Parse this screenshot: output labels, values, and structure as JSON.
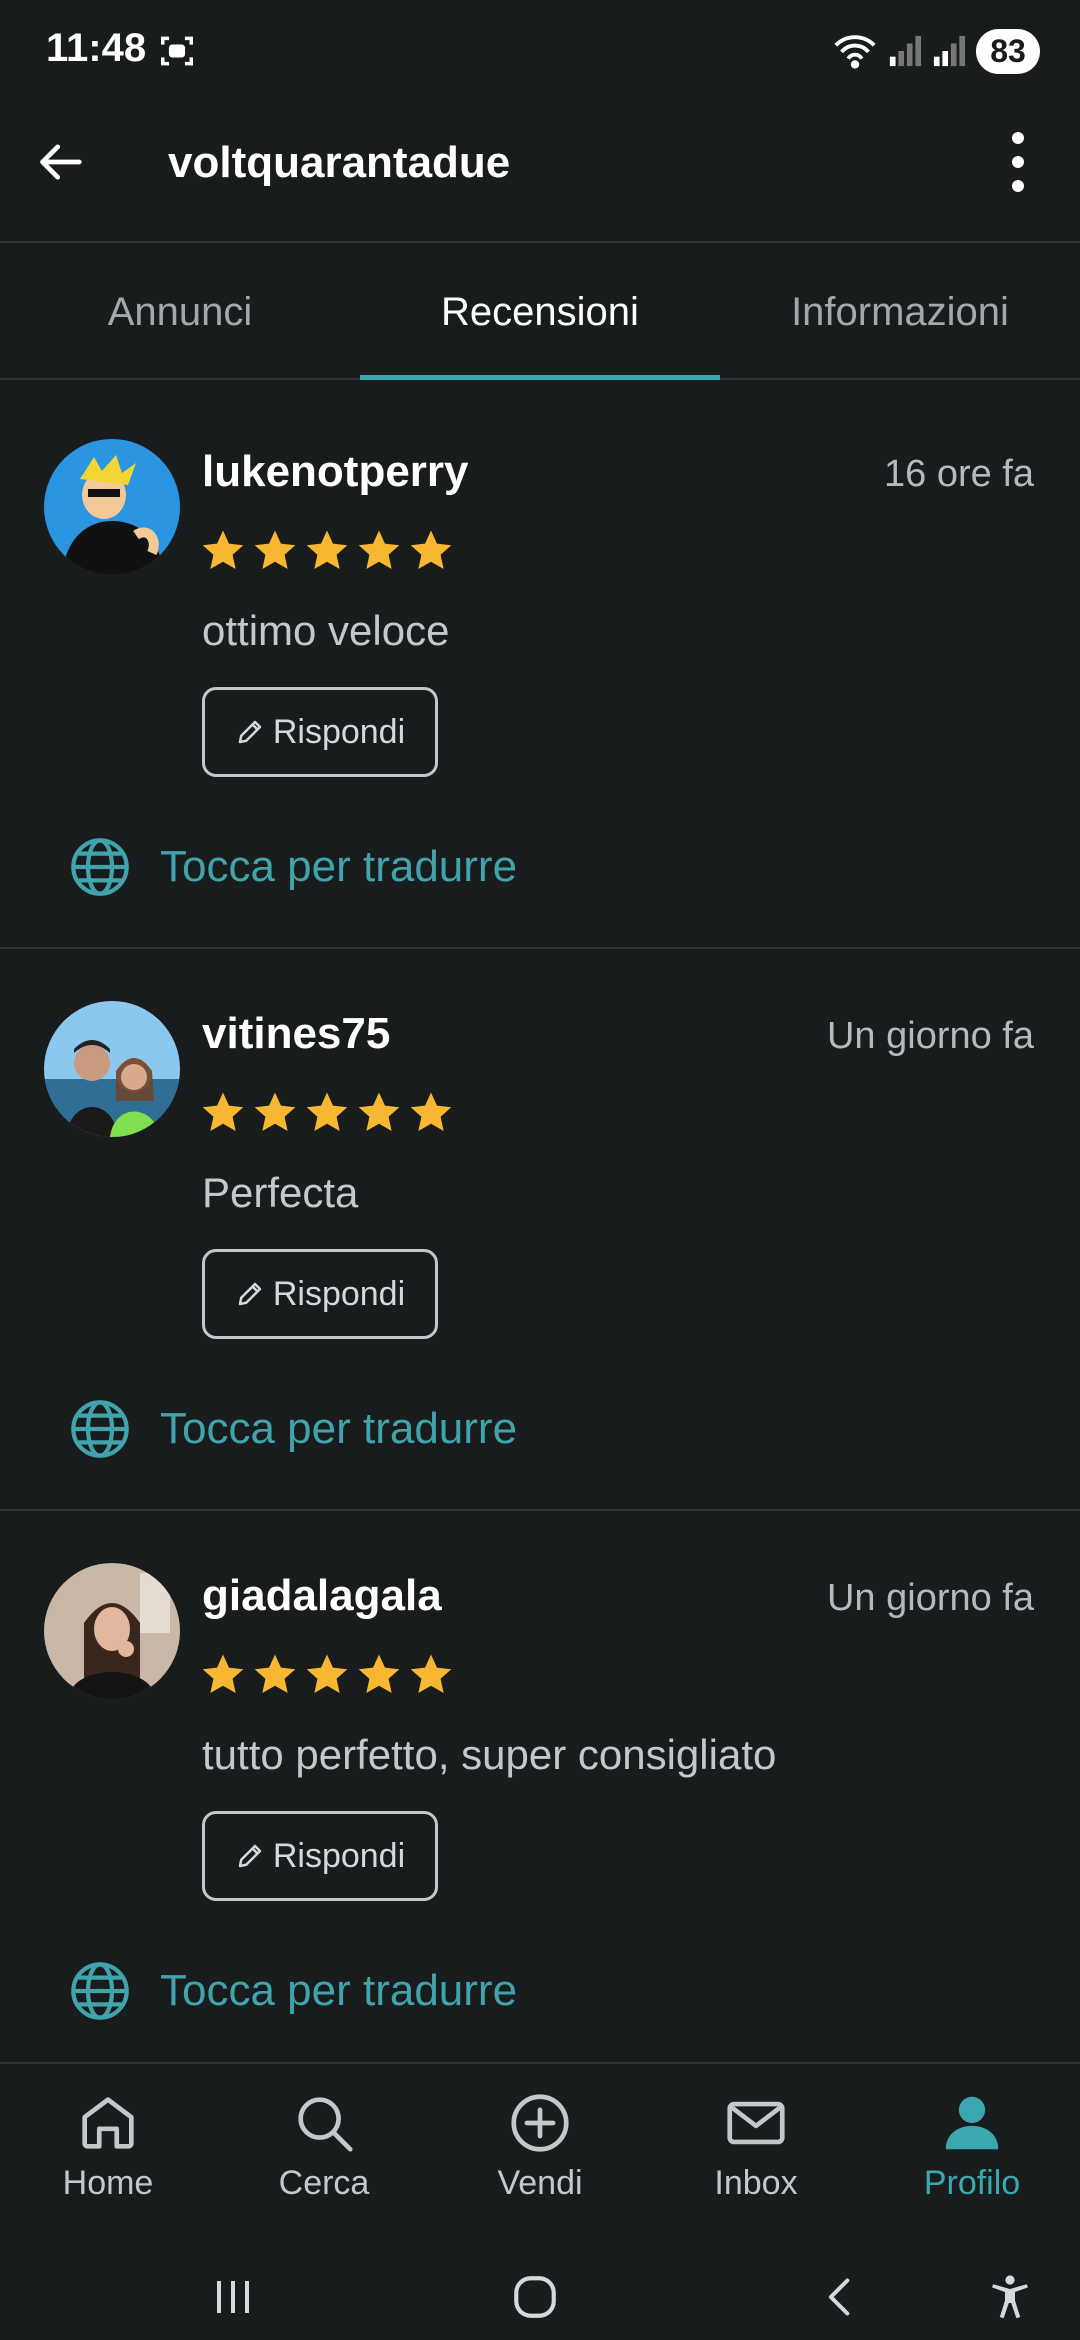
{
  "status": {
    "time": "11:48",
    "battery": "83"
  },
  "appbar": {
    "title": "voltquarantadue"
  },
  "tabs": [
    {
      "label": "Annunci"
    },
    {
      "label": "Recensioni",
      "active": true
    },
    {
      "label": "Informazioni"
    }
  ],
  "reviews": [
    {
      "username": "lukenotperry",
      "time": "16 ore fa",
      "rating": 5,
      "text": "ottimo veloce",
      "reply_label": "Rispondi",
      "translate_label": "Tocca per tradurre"
    },
    {
      "username": "vitines75",
      "time": "Un giorno fa",
      "rating": 5,
      "text": "Perfecta",
      "reply_label": "Rispondi",
      "translate_label": "Tocca per tradurre"
    },
    {
      "username": "giadalagala",
      "time": "Un giorno fa",
      "rating": 5,
      "text": "tutto perfetto, super consigliato",
      "reply_label": "Rispondi",
      "translate_label": "Tocca per tradurre"
    }
  ],
  "bottom_nav": [
    {
      "label": "Home",
      "icon": "home-icon"
    },
    {
      "label": "Cerca",
      "icon": "search-icon"
    },
    {
      "label": "Vendi",
      "icon": "add-circle-icon"
    },
    {
      "label": "Inbox",
      "icon": "mail-icon"
    },
    {
      "label": "Profilo",
      "icon": "person-icon",
      "active": true
    }
  ],
  "colors": {
    "background": "#181c1d",
    "accent": "#3aa8b0",
    "star": "#f7b731",
    "divider": "#2e3335"
  }
}
